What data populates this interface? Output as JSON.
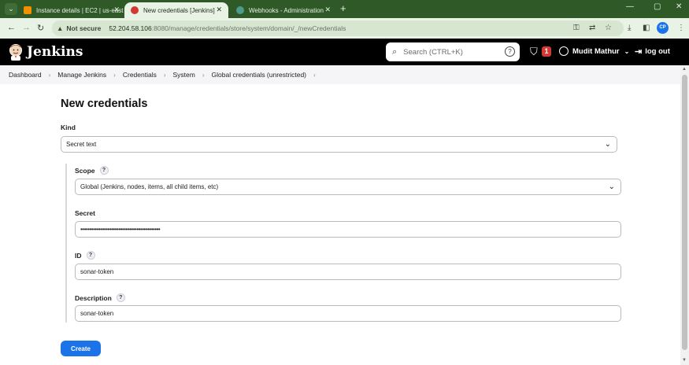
{
  "browser": {
    "tabs": [
      {
        "title": "Instance details | EC2 | us-east",
        "favicon_color": "#f29100",
        "active": false
      },
      {
        "title": "New credentials [Jenkins]",
        "favicon_color": "#d33833",
        "active": true
      },
      {
        "title": "Webhooks - Administration",
        "favicon_color": "#4e9a8b",
        "active": false
      }
    ],
    "security_label": "Not secure",
    "url_host": "52.204.58.106",
    "url_path": ":8080/manage/credentials/store/system/domain/_/newCredentials",
    "profile_initials": "CP"
  },
  "header": {
    "title": "Jenkins",
    "search_placeholder": "Search (CTRL+K)",
    "notification_count": "1",
    "user_name": "Mudit Mathur",
    "logout_label": "log out"
  },
  "breadcrumbs": [
    "Dashboard",
    "Manage Jenkins",
    "Credentials",
    "System",
    "Global credentials (unrestricted)"
  ],
  "form": {
    "page_title": "New credentials",
    "kind_label": "Kind",
    "kind_value": "Secret text",
    "scope_label": "Scope",
    "scope_value": "Global (Jenkins, nodes, items, all child items, etc)",
    "secret_label": "Secret",
    "secret_value": "••••••••••••••••••••••••••••••••••••••••••••",
    "id_label": "ID",
    "id_value": "sonar-token",
    "description_label": "Description",
    "description_value": "sonar-token",
    "help_glyph": "?",
    "create_label": "Create"
  },
  "colors": {
    "accent": "#1a73e8",
    "jenkins_header": "#000000",
    "chrome_frame": "#2f5a27",
    "badge": "#d33833"
  }
}
